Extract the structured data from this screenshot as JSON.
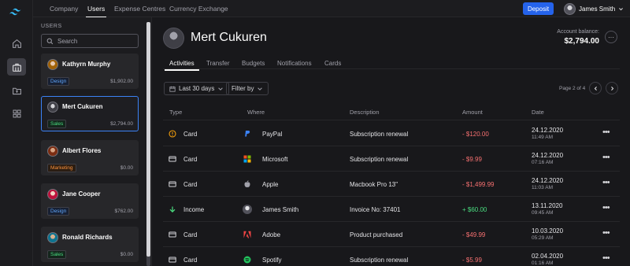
{
  "topnav": {
    "tabs": [
      "Company",
      "Users",
      "Expense Centres",
      "Currency Exchange"
    ],
    "active_tab": "Users",
    "deposit_label": "Deposit",
    "user_name": "James Smith"
  },
  "users_panel": {
    "title": "USERS",
    "search_placeholder": "Search",
    "users": [
      {
        "name": "Kathyrn Murphy",
        "tag": "Design",
        "amount": "$1,902.00",
        "tag_color": "blue"
      },
      {
        "name": "Mert Cukuren",
        "tag": "Sales",
        "amount": "$2,794.00",
        "tag_color": "green",
        "selected": true
      },
      {
        "name": "Albert Flores",
        "tag": "Marketing",
        "amount": "$0.00",
        "tag_color": "orange"
      },
      {
        "name": "Jane Cooper",
        "tag": "Design",
        "amount": "$762.00",
        "tag_color": "blue"
      },
      {
        "name": "Ronald Richards",
        "tag": "Sales",
        "amount": "$0.00",
        "tag_color": "green"
      }
    ]
  },
  "profile": {
    "name": "Mert Cukuren",
    "balance_label": "Account balance:",
    "balance_value": "$2,794.00"
  },
  "subtabs": [
    "Activities",
    "Transfer",
    "Budgets",
    "Notifications",
    "Cards"
  ],
  "filters": {
    "date_range": "Last 30 days",
    "filter_by": "Filter by",
    "page_info": "Page 2 of 4"
  },
  "table": {
    "headers": [
      "Type",
      "Where",
      "Description",
      "Amount",
      "Date"
    ],
    "rows": [
      {
        "type": "Card",
        "type_icon": "alert-icon",
        "where": "PayPal",
        "where_icon": "paypal-icon",
        "description": "Subscription renewal",
        "amount": "- $120.00",
        "sign": "neg",
        "date": "24.12.2020",
        "time": "11:49 AM"
      },
      {
        "type": "Card",
        "type_icon": "card-icon",
        "where": "Microsoft",
        "where_icon": "microsoft-icon",
        "description": "Subscription renewal",
        "amount": "- $9.99",
        "sign": "neg",
        "date": "24.12.2020",
        "time": "07:16 AM"
      },
      {
        "type": "Card",
        "type_icon": "card-icon",
        "where": "Apple",
        "where_icon": "apple-icon",
        "description": "Macbook Pro 13\"",
        "amount": "- $1,499.99",
        "sign": "neg",
        "date": "24.12.2020",
        "time": "11:03 AM"
      },
      {
        "type": "Income",
        "type_icon": "arrow-down-icon",
        "where": "James Smith",
        "where_icon": "avatar",
        "description": "Invoice No: 37401",
        "amount": "+ $60.00",
        "sign": "pos",
        "date": "13.11.2020",
        "time": "09:45 AM"
      },
      {
        "type": "Card",
        "type_icon": "card-icon",
        "where": "Adobe",
        "where_icon": "adobe-icon",
        "description": "Product purchased",
        "amount": "- $49.99",
        "sign": "neg",
        "date": "10.03.2020",
        "time": "05:29 AM"
      },
      {
        "type": "Card",
        "type_icon": "card-icon",
        "where": "Spotify",
        "where_icon": "spotify-icon",
        "description": "Subscription renewal",
        "amount": "- $5.99",
        "sign": "neg",
        "date": "02.04.2020",
        "time": "01:16 AM"
      }
    ]
  },
  "colors": {
    "accent": "#2563eb",
    "negative": "#f87171",
    "positive": "#4ade80",
    "selected_border": "#3b82f6"
  }
}
